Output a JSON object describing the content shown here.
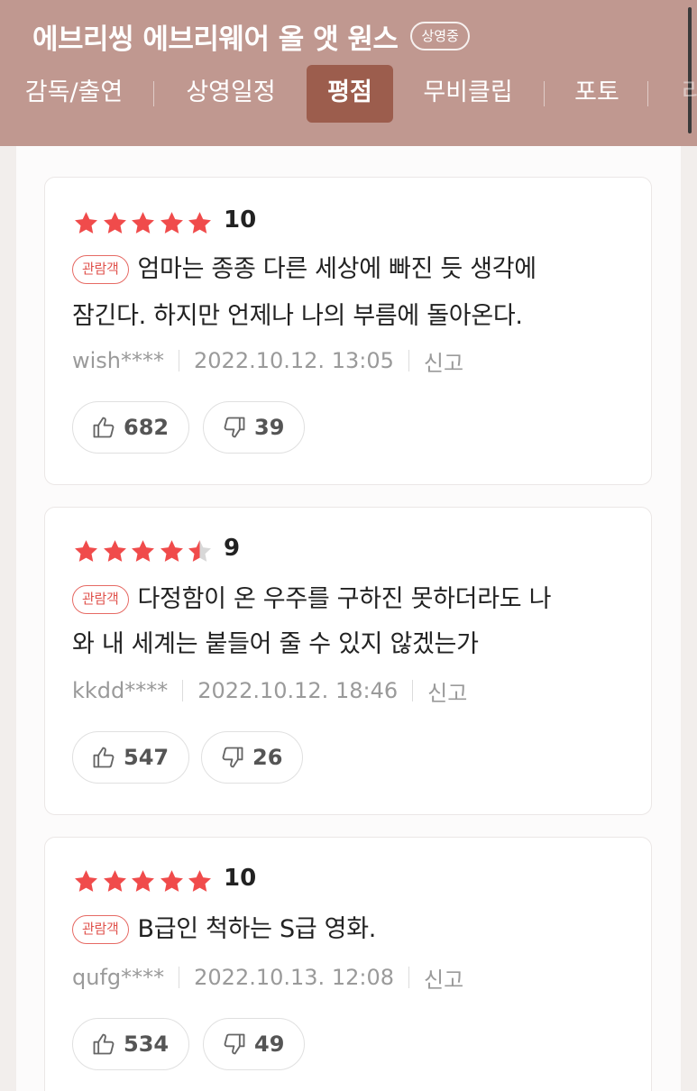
{
  "header": {
    "title": "에브리씽 에브리웨어 올 앳 원스",
    "status_badge": "상영중",
    "tabs": [
      {
        "label": "감독/출연"
      },
      {
        "label": "상영일정"
      },
      {
        "label": "평점"
      },
      {
        "label": "무비클립"
      },
      {
        "label": "포토"
      },
      {
        "label": "리"
      }
    ],
    "active_tab": "평점"
  },
  "colors": {
    "header_bg": "#c09890",
    "active_tab_bg": "#9c5d4d",
    "star_red": "#f04b4b",
    "badge_red": "#e0524c"
  },
  "reviews": [
    {
      "rating": 5,
      "score": "10",
      "badge": "관람객",
      "text_line1": "엄마는 종종 다른 세상에 빠진 듯 생각에",
      "text_line2": "잠긴다. 하지만 언제나 나의 부름에 돌아온다.",
      "author": "wish****",
      "datetime": "2022.10.12. 13:05",
      "report": "신고",
      "likes": "682",
      "dislikes": "39"
    },
    {
      "rating": 4.5,
      "score": "9",
      "badge": "관람객",
      "text_line1": "다정함이 온 우주를 구하진 못하더라도 나",
      "text_line2": "와 내 세계는 붙들어 줄 수 있지 않겠는가",
      "author": "kkdd****",
      "datetime": "2022.10.12. 18:46",
      "report": "신고",
      "likes": "547",
      "dislikes": "26"
    },
    {
      "rating": 5,
      "score": "10",
      "badge": "관람객",
      "text_line1": "B급인 척하는 S급 영화.",
      "text_line2": "",
      "author": "qufg****",
      "datetime": "2022.10.13. 12:08",
      "report": "신고",
      "likes": "534",
      "dislikes": "49"
    }
  ]
}
